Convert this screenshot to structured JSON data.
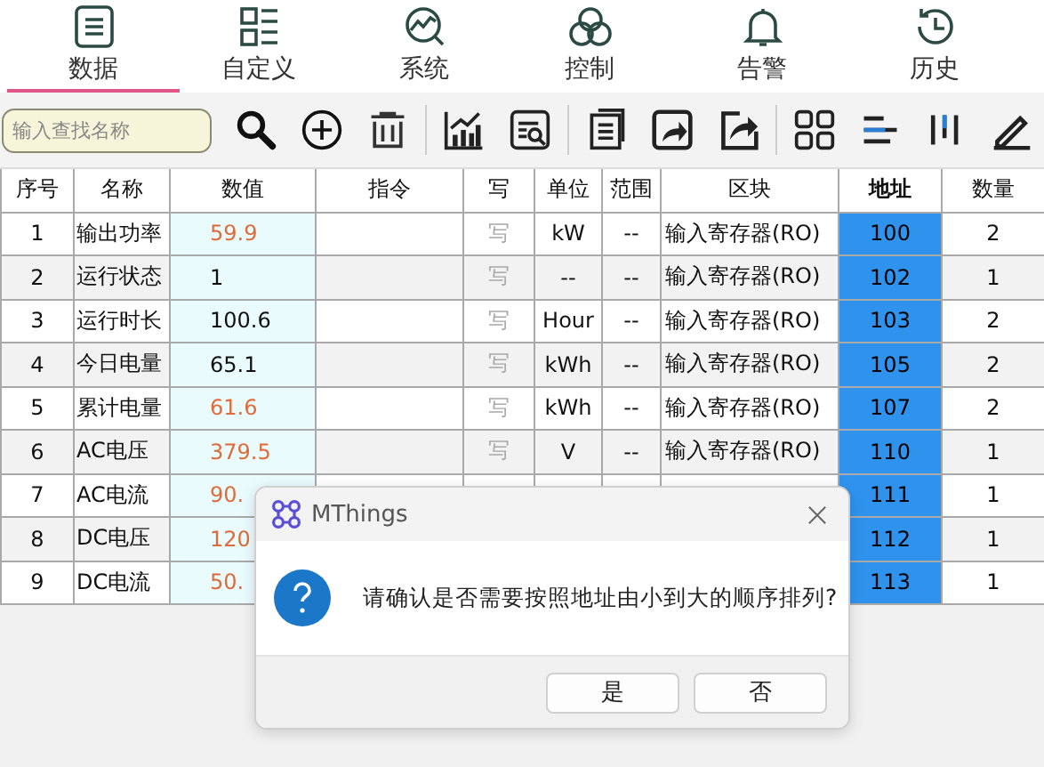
{
  "tabs": [
    {
      "label": "数据",
      "selected": true
    },
    {
      "label": "自定义",
      "selected": false
    },
    {
      "label": "系统",
      "selected": false
    },
    {
      "label": "控制",
      "selected": false
    },
    {
      "label": "告警",
      "selected": false
    },
    {
      "label": "历史",
      "selected": false
    }
  ],
  "search": {
    "placeholder": "输入查找名称"
  },
  "table": {
    "columns": [
      {
        "label": "序号",
        "highlighted": false
      },
      {
        "label": "名称",
        "highlighted": false
      },
      {
        "label": "数值",
        "highlighted": false
      },
      {
        "label": "指令",
        "highlighted": false
      },
      {
        "label": "写",
        "highlighted": false
      },
      {
        "label": "单位",
        "highlighted": false
      },
      {
        "label": "范围",
        "highlighted": false
      },
      {
        "label": "区块",
        "highlighted": false
      },
      {
        "label": "地址",
        "highlighted": true
      },
      {
        "label": "数量",
        "highlighted": false
      }
    ],
    "rows": [
      {
        "index": "1",
        "name": "输出功率",
        "value": "59.9",
        "changed": true,
        "write": "写",
        "unit": "kW",
        "range": "--",
        "block": "输入寄存器(RO)",
        "address": "100",
        "count": "2"
      },
      {
        "index": "2",
        "name": "运行状态",
        "value": "1",
        "changed": false,
        "write": "写",
        "unit": "--",
        "range": "--",
        "block": "输入寄存器(RO)",
        "address": "102",
        "count": "1"
      },
      {
        "index": "3",
        "name": "运行时长",
        "value": "100.6",
        "changed": false,
        "write": "写",
        "unit": "Hour",
        "range": "--",
        "block": "输入寄存器(RO)",
        "address": "103",
        "count": "2"
      },
      {
        "index": "4",
        "name": "今日电量",
        "value": "65.1",
        "changed": false,
        "write": "写",
        "unit": "kWh",
        "range": "--",
        "block": "输入寄存器(RO)",
        "address": "105",
        "count": "2"
      },
      {
        "index": "5",
        "name": "累计电量",
        "value": "61.6",
        "changed": true,
        "write": "写",
        "unit": "kWh",
        "range": "--",
        "block": "输入寄存器(RO)",
        "address": "107",
        "count": "2"
      },
      {
        "index": "6",
        "name": "AC电压",
        "value": "379.5",
        "changed": true,
        "write": "写",
        "unit": "V",
        "range": "--",
        "block": "输入寄存器(RO)",
        "address": "110",
        "count": "1"
      },
      {
        "index": "7",
        "name": "AC电流",
        "value": "90.",
        "changed": true,
        "address": "111",
        "count": "1"
      },
      {
        "index": "8",
        "name": "DC电压",
        "value": "120",
        "changed": true,
        "address": "112",
        "count": "1"
      },
      {
        "index": "9",
        "name": "DC电流",
        "value": "50.",
        "changed": true,
        "address": "113",
        "count": "1"
      }
    ]
  },
  "dialog": {
    "title": "MThings",
    "message": "请确认是否需要按照地址由小到大的顺序排列?",
    "buttons": [
      "是",
      "否"
    ]
  }
}
